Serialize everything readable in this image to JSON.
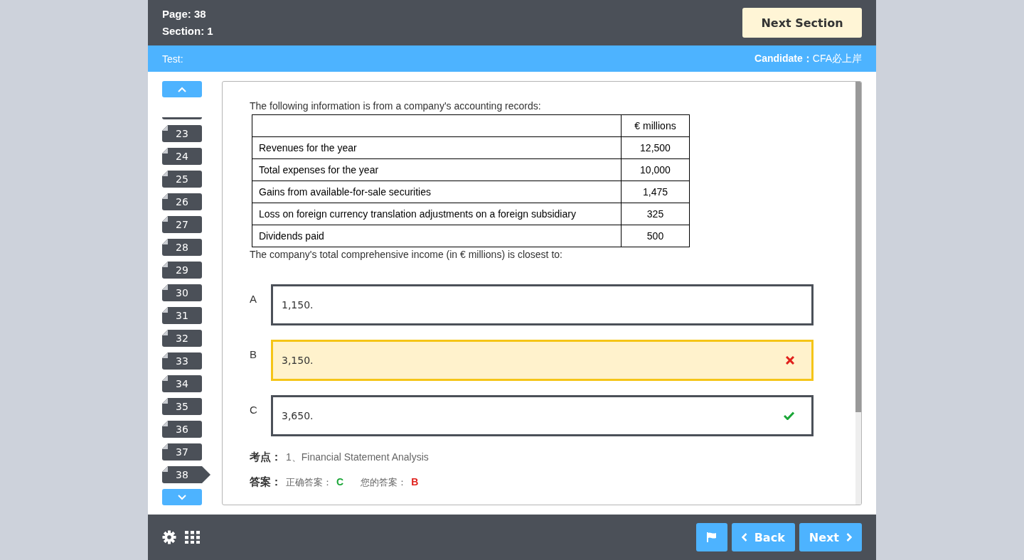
{
  "header": {
    "page_label": "Page: 38",
    "section_label": "Section: 1",
    "next_section_button": "Next Section"
  },
  "info_bar": {
    "test_label": "Test:",
    "candidate_label": "Candidate：",
    "candidate_name": "CFA必上岸"
  },
  "sidebar": {
    "items": [
      {
        "label": "23",
        "selected": false
      },
      {
        "label": "24",
        "selected": false
      },
      {
        "label": "25",
        "selected": false
      },
      {
        "label": "26",
        "selected": false
      },
      {
        "label": "27",
        "selected": false
      },
      {
        "label": "28",
        "selected": false
      },
      {
        "label": "29",
        "selected": false
      },
      {
        "label": "30",
        "selected": false
      },
      {
        "label": "31",
        "selected": false
      },
      {
        "label": "32",
        "selected": false
      },
      {
        "label": "33",
        "selected": false
      },
      {
        "label": "34",
        "selected": false
      },
      {
        "label": "35",
        "selected": false
      },
      {
        "label": "36",
        "selected": false
      },
      {
        "label": "37",
        "selected": false
      },
      {
        "label": "38",
        "selected": true
      }
    ]
  },
  "question": {
    "intro": "The following information is from a company's accounting records:",
    "table": {
      "columns": [
        "",
        "€ millions"
      ],
      "rows": [
        [
          "Revenues for the year",
          "12,500"
        ],
        [
          "Total expenses for the year",
          "10,000"
        ],
        [
          "Gains from available-for-sale securities",
          "1,475"
        ],
        [
          "Loss on foreign currency translation adjustments on a foreign subsidiary",
          "325"
        ],
        [
          "Dividends paid",
          "500"
        ]
      ]
    },
    "prompt": "The company's total comprehensive income (in € millions) is closest to:",
    "choices": [
      {
        "letter": "A",
        "text": "1,150.",
        "selected": false,
        "kind": "plain"
      },
      {
        "letter": "B",
        "text": "3,150.",
        "selected": true,
        "kind": "wrong"
      },
      {
        "letter": "C",
        "text": "3,650.",
        "selected": false,
        "kind": "correct"
      }
    ],
    "topic": {
      "label": "考点：",
      "value": "1、Financial Statement Analysis"
    },
    "answer": {
      "label": "答案：",
      "correct_label": "正确答案：",
      "correct_value": "C",
      "your_label": "您的答案：",
      "your_value": "B"
    }
  },
  "footer": {
    "back_button": "Back",
    "next_button": "Next"
  }
}
